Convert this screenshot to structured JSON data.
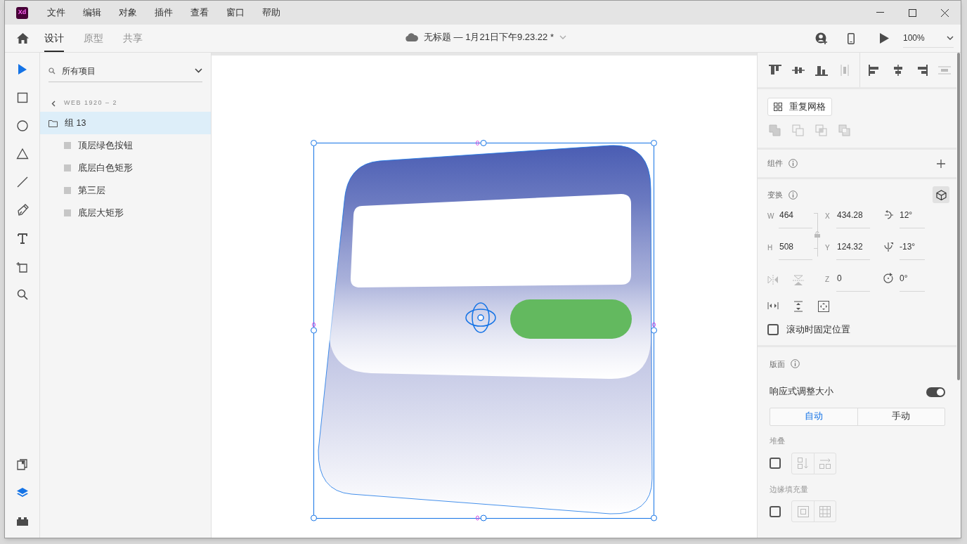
{
  "app": {
    "logo": "Xd"
  },
  "menu": [
    "文件",
    "编辑",
    "对象",
    "插件",
    "查看",
    "窗口",
    "帮助"
  ],
  "tabs": [
    {
      "label": "设计",
      "selected": true
    },
    {
      "label": "原型",
      "selected": false
    },
    {
      "label": "共享",
      "selected": false
    }
  ],
  "document": {
    "title": "无标题 — 1月21日下午9.23.22 *"
  },
  "zoom": {
    "value": "100%"
  },
  "tools": [
    {
      "kind": "select",
      "selected": true
    },
    {
      "kind": "rectangle",
      "selected": false
    },
    {
      "kind": "ellipse",
      "selected": false
    },
    {
      "kind": "polygon",
      "selected": false
    },
    {
      "kind": "line",
      "selected": false
    },
    {
      "kind": "pen",
      "selected": false
    },
    {
      "kind": "text",
      "selected": false
    },
    {
      "kind": "artboard",
      "selected": false
    },
    {
      "kind": "zoom",
      "selected": false
    }
  ],
  "panels": [
    {
      "kind": "assets",
      "selected": false
    },
    {
      "kind": "layers",
      "selected": true
    },
    {
      "kind": "plugins",
      "selected": false
    }
  ],
  "layers": {
    "filter": "所有项目",
    "breadcrumb": "WEB 1920 – 2",
    "items": [
      {
        "label": "组 13",
        "selected": true,
        "children": [
          {
            "label": "顶层绿色按钮",
            "selected": false
          },
          {
            "label": "底层白色矩形",
            "selected": false
          },
          {
            "label": "第三层",
            "selected": false
          },
          {
            "label": "底层大矩形",
            "selected": false
          }
        ]
      }
    ]
  },
  "properties": {
    "repeat_grid": "重复网格",
    "component": {
      "title": "组件"
    },
    "transform": {
      "title": "变换",
      "rows": [
        [
          {
            "kind": "field",
            "label": "W",
            "value": "464"
          },
          {
            "kind": "field",
            "label": "X",
            "value": "434.28"
          },
          {
            "kind": "rotate_x",
            "value": "12°"
          }
        ],
        [
          {
            "kind": "field",
            "label": "H",
            "value": "508"
          },
          {
            "kind": "field",
            "label": "Y",
            "value": "124.32"
          },
          {
            "kind": "rotate_y",
            "value": "-13°"
          }
        ],
        [
          {
            "kind": "flip"
          },
          {
            "kind": "field",
            "label": "Z",
            "value": "0"
          },
          {
            "kind": "rotate",
            "value": "0°"
          }
        ]
      ],
      "fix_position": {
        "label": "滚动时固定位置",
        "checked": false
      }
    },
    "layout": {
      "title": "版面",
      "responsive": {
        "label": "响应式调整大小",
        "on": true
      },
      "modes": [
        {
          "label": "自动",
          "selected": true
        },
        {
          "label": "手动",
          "selected": false
        }
      ],
      "stack": {
        "title": "堆叠",
        "checked": false
      },
      "padding": {
        "title": "边缘填充量",
        "checked": false
      }
    }
  }
}
